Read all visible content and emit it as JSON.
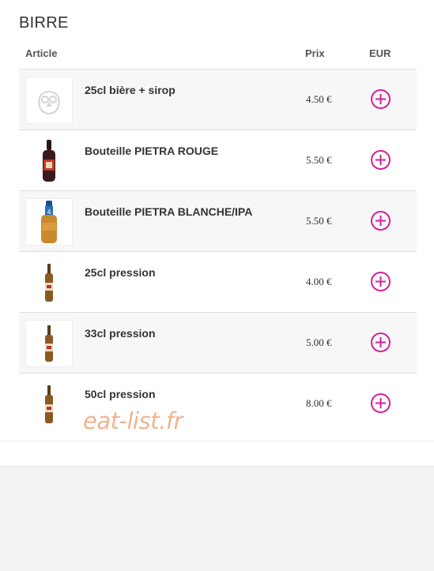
{
  "section": {
    "title": "BIRRE"
  },
  "table": {
    "headers": {
      "article": "Article",
      "price": "Prix",
      "currency": "EUR"
    },
    "rows": [
      {
        "name": "25cl bière + sirop",
        "price": "4.50 €",
        "image": "placeholder-logo-icon"
      },
      {
        "name": "Bouteille PIETRA ROUGE",
        "price": "5.50 €",
        "image": "red-beer-bottle-icon"
      },
      {
        "name": "Bouteille PIETRA BLANCHE/IPA",
        "price": "5.50 €",
        "image": "white-ipa-bottle-icon"
      },
      {
        "name": "25cl pression",
        "price": "4.00 €",
        "image": "beer-bottle-icon"
      },
      {
        "name": "33cl pression",
        "price": "5.00 €",
        "image": "beer-bottle-icon"
      },
      {
        "name": "50cl pression",
        "price": "8.00 €",
        "image": "beer-bottle-icon"
      }
    ]
  },
  "watermark": "eat-list.fr",
  "colors": {
    "accent": "#d6219b",
    "watermark": "#f2b38f"
  },
  "icons": {
    "add": "plus-circle-icon"
  }
}
